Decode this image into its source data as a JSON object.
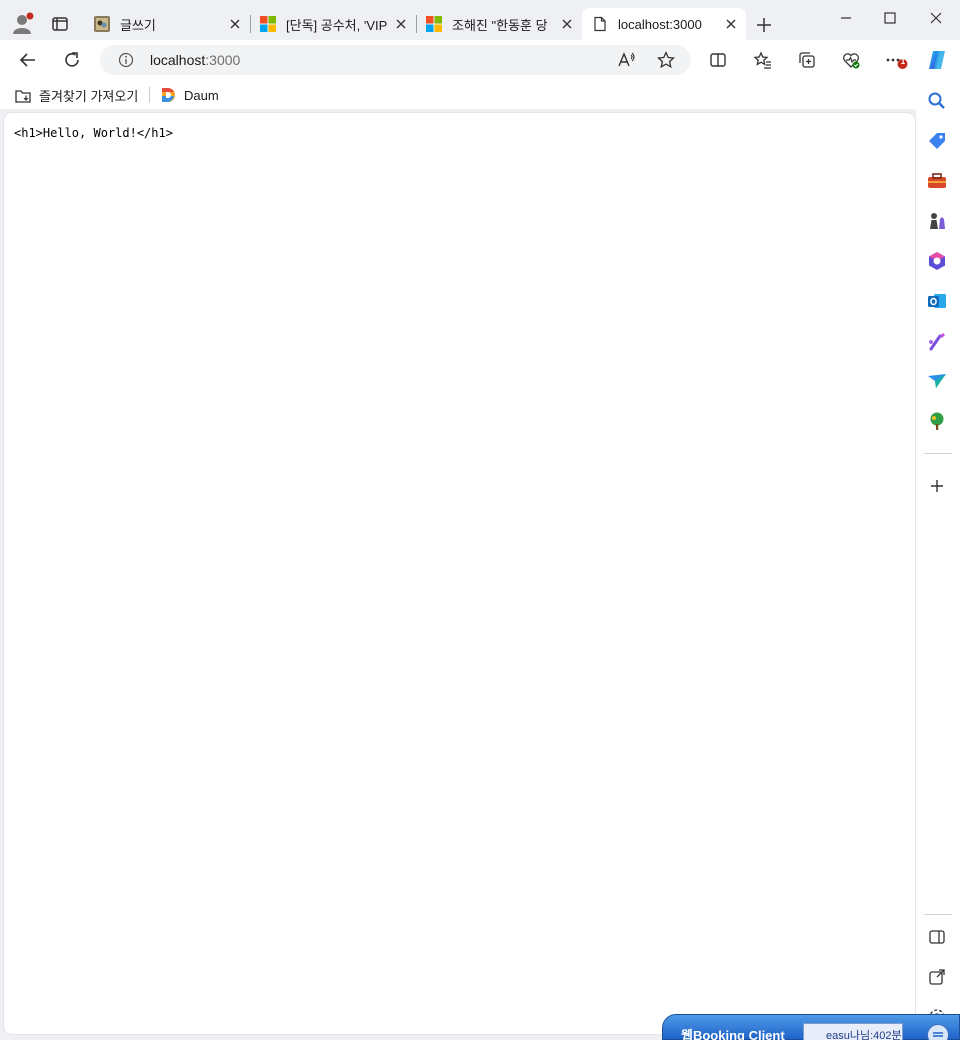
{
  "tabs": [
    {
      "title": "글쓰기",
      "favicon": "blog-icon",
      "active": false
    },
    {
      "title": "[단독] 공수처, 'VIP",
      "favicon": "msn-icon",
      "active": false
    },
    {
      "title": "조해진 \"한동훈 당",
      "favicon": "msn-icon",
      "active": false
    },
    {
      "title": "localhost:3000",
      "favicon": "page-icon",
      "active": true
    }
  ],
  "address": {
    "host": "localhost",
    "port": ":3000"
  },
  "favorites": [
    {
      "label": "즐겨찾기 가져오기",
      "icon": "import-favorites-icon"
    },
    {
      "label": "Daum",
      "icon": "daum-icon"
    }
  ],
  "page": {
    "content": "<h1>Hello, World!</h1>"
  },
  "badges": {
    "more_notification": "1"
  },
  "webbooking": {
    "title": "웹Booking Client",
    "field": "easu나님:402분"
  },
  "colors": {
    "accent": "#0f6cbd",
    "badge": "#c42b1c",
    "tab_bar": "#eff0f3"
  }
}
